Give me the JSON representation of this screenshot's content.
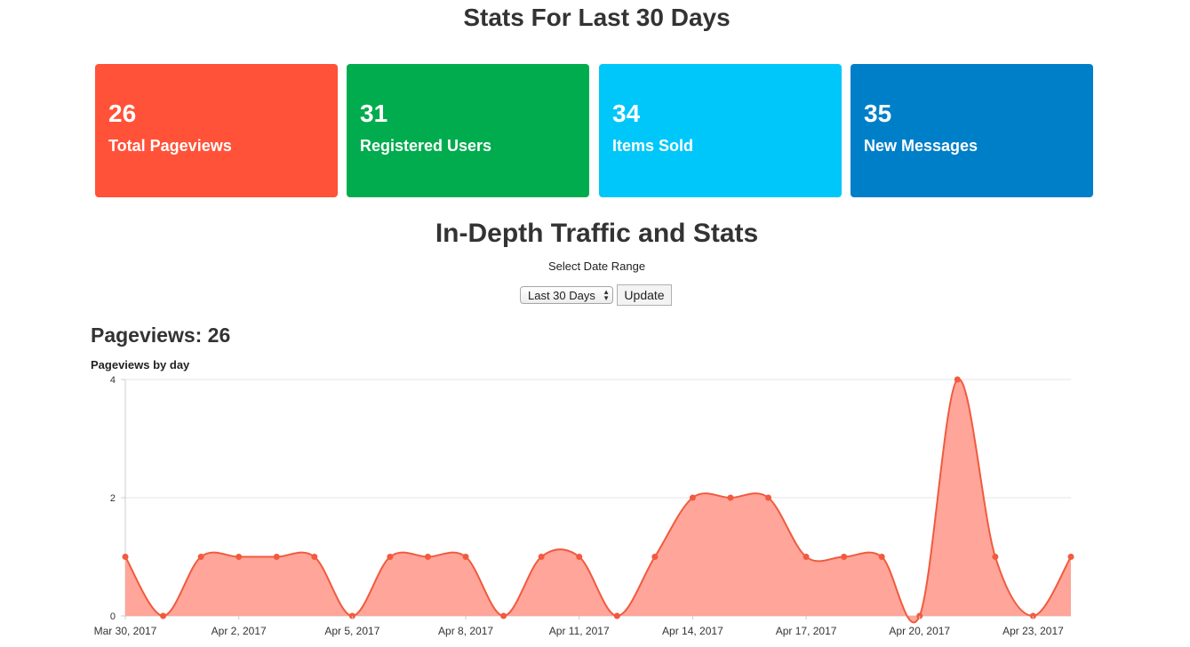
{
  "page": {
    "title": "Stats For Last 30 Days"
  },
  "stats": [
    {
      "value": "26",
      "label": "Total Pageviews",
      "color": "#ff5238"
    },
    {
      "value": "31",
      "label": "Registered Users",
      "color": "#00ac4e"
    },
    {
      "value": "34",
      "label": "Items Sold",
      "color": "#00c7fa"
    },
    {
      "value": "35",
      "label": "New Messages",
      "color": "#007fc9"
    }
  ],
  "traffic": {
    "title": "In-Depth Traffic and Stats",
    "range_label": "Select Date Range",
    "range_selected": "Last 30 Days",
    "update_label": "Update",
    "pageviews_heading": "Pageviews: 26"
  },
  "chart_data": {
    "type": "area",
    "title": "Pageviews by day",
    "x": [
      "Mar 30, 2017",
      "Mar 31, 2017",
      "Apr 1, 2017",
      "Apr 2, 2017",
      "Apr 3, 2017",
      "Apr 4, 2017",
      "Apr 5, 2017",
      "Apr 6, 2017",
      "Apr 7, 2017",
      "Apr 8, 2017",
      "Apr 9, 2017",
      "Apr 10, 2017",
      "Apr 11, 2017",
      "Apr 12, 2017",
      "Apr 13, 2017",
      "Apr 14, 2017",
      "Apr 15, 2017",
      "Apr 16, 2017",
      "Apr 17, 2017",
      "Apr 18, 2017",
      "Apr 19, 2017",
      "Apr 20, 2017",
      "Apr 21, 2017",
      "Apr 22, 2017",
      "Apr 23, 2017",
      "Apr 24, 2017"
    ],
    "series": [
      {
        "values": [
          1,
          0,
          1,
          1,
          1,
          1,
          0,
          1,
          1,
          1,
          0,
          1,
          1,
          0,
          1,
          2,
          2,
          2,
          1,
          1,
          1,
          0,
          4,
          1,
          0,
          1
        ]
      }
    ],
    "x_ticks": [
      "Mar 30, 2017",
      "Apr 2, 2017",
      "Apr 5, 2017",
      "Apr 8, 2017",
      "Apr 11, 2017",
      "Apr 14, 2017",
      "Apr 17, 2017",
      "Apr 20, 2017",
      "Apr 23, 2017"
    ],
    "y_ticks": [
      "0",
      "2",
      "4"
    ],
    "ylim": [
      0,
      4
    ],
    "grid": true,
    "line_color": "#f15a3f",
    "fill_color": "#ffa599"
  }
}
